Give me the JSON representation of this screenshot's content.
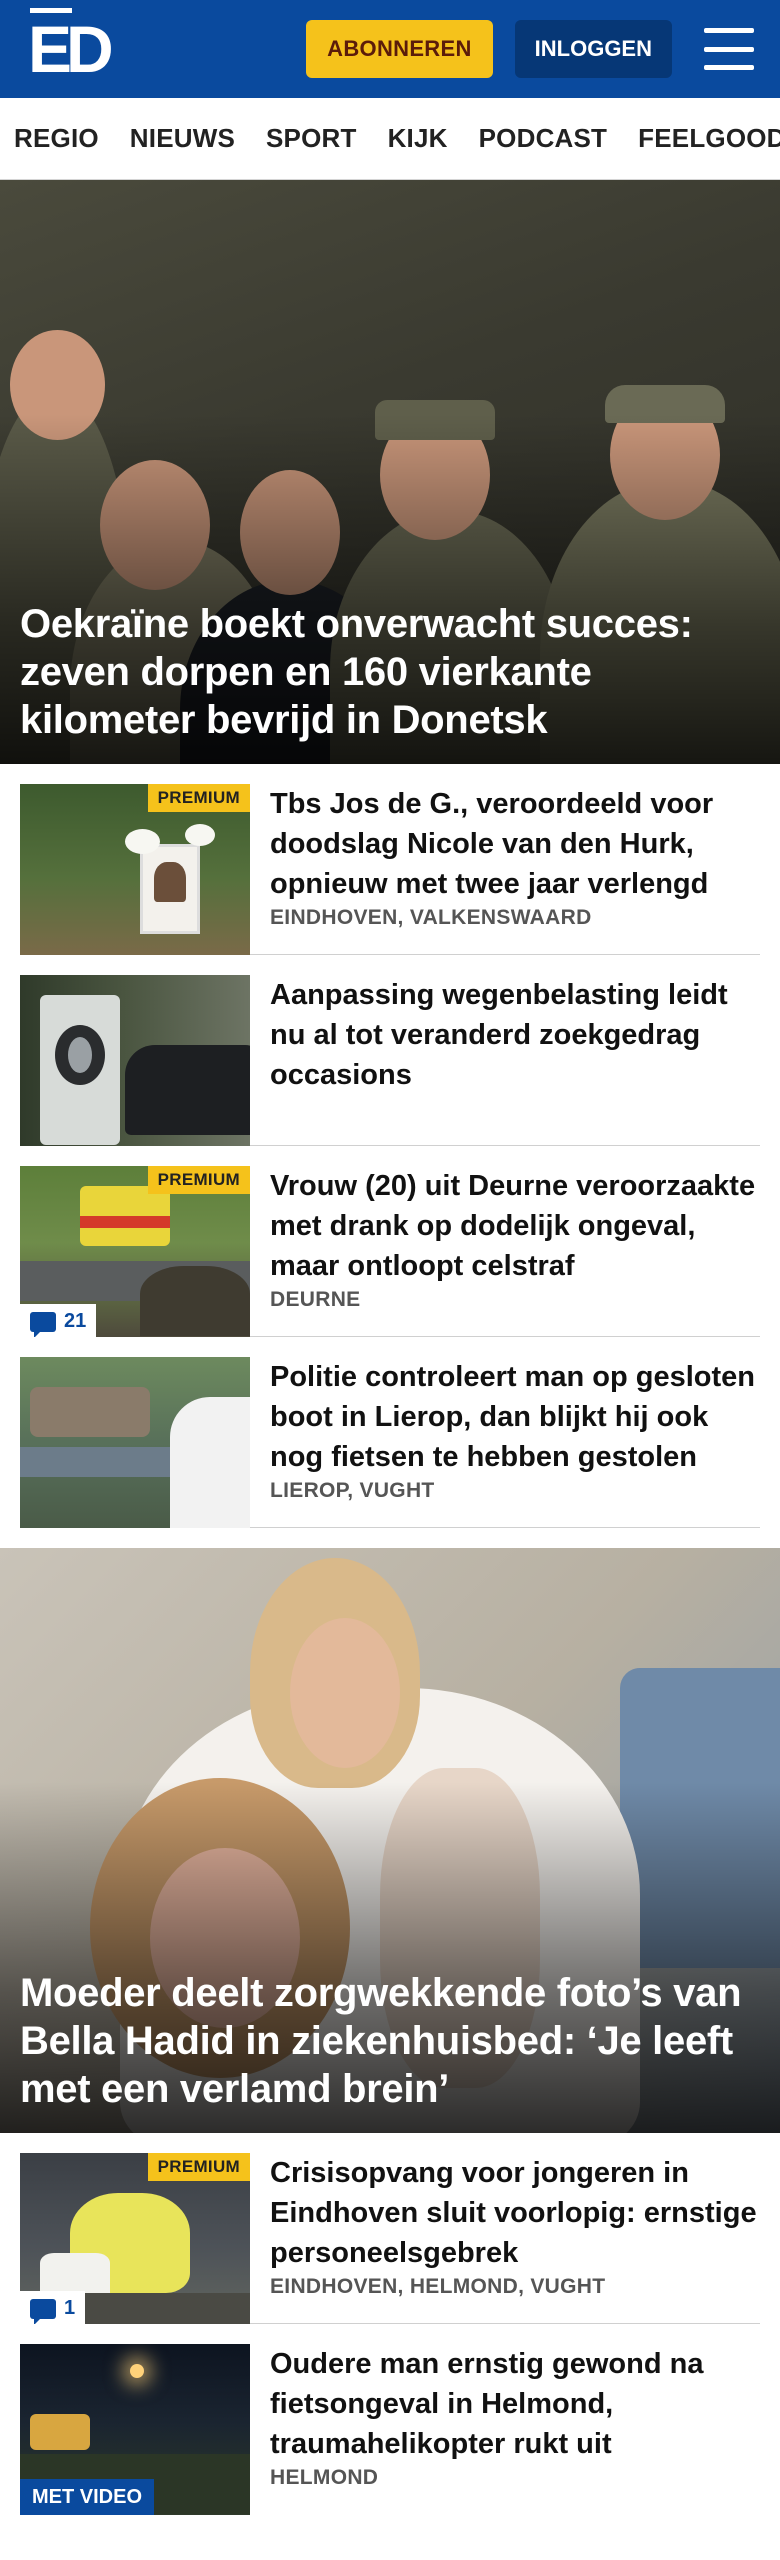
{
  "header": {
    "logo": "ED",
    "subscribe_label": "ABONNEREN",
    "login_label": "INLOGGEN",
    "colors": {
      "brand": "#0a4a9e",
      "accent": "#f5c21b"
    }
  },
  "nav": {
    "items": [
      "REGIO",
      "NIEUWS",
      "SPORT",
      "KIJK",
      "PODCAST",
      "FEELGOOD"
    ]
  },
  "hero1": {
    "title": "Oekraïne boekt onverwacht succes: zeven dorpen en 160 vierkante kilometer bevrijd in Donetsk"
  },
  "list1": [
    {
      "title": "Tbs Jos de G., veroordeeld voor doodslag Nicole van den Hurk, opnieuw met twee jaar verlengd",
      "location": "EINDHOVEN, VALKENSWAARD",
      "badge": "PREMIUM"
    },
    {
      "title": "Aanpassing wegenbelasting leidt nu al tot veranderd zoekgedrag occasions",
      "location": ""
    },
    {
      "title": "Vrouw (20) uit Deurne veroorzaakte met drank op dodelijk ongeval, maar ontloopt celstraf",
      "location": "DEURNE",
      "badge": "PREMIUM",
      "comments": "21"
    },
    {
      "title": "Politie controleert man op gesloten boot in Lierop, dan blijkt hij ook nog fietsen te hebben gestolen",
      "location": "LIEROP, VUGHT"
    }
  ],
  "hero2": {
    "title": "Moeder deelt zorgwekkende foto’s van Bella Hadid in ziekenhuisbed: ‘Je leeft met een verlamd brein’"
  },
  "list2": [
    {
      "title": "Crisisopvang voor jongeren in Eindhoven sluit voorlopig: ernstige personeelsgebrek",
      "location": "EINDHOVEN, HELMOND, VUGHT",
      "badge": "PREMIUM",
      "comments": "1"
    },
    {
      "title": "Oudere man ernstig gewond na fietsongeval in Helmond, traumahelikopter rukt uit",
      "location": "HELMOND",
      "video": "MET VIDEO"
    }
  ]
}
